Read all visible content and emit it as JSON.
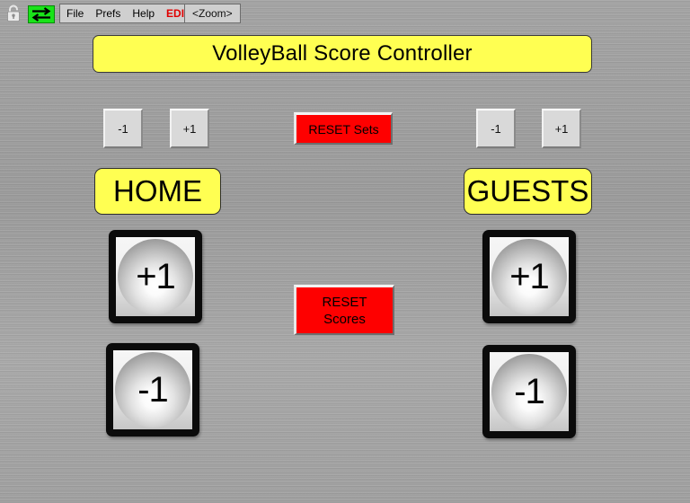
{
  "menubar": {
    "lock_icon": "padlock-unlocked-icon",
    "swap_icon": "swap-arrows-icon",
    "items": [
      {
        "label": "File",
        "style": "normal"
      },
      {
        "label": "Prefs",
        "style": "normal"
      },
      {
        "label": "Help",
        "style": "normal"
      },
      {
        "label": "EDIT",
        "style": "edit"
      }
    ],
    "zoom_button": "<Zoom>"
  },
  "title": {
    "text": "VolleyBall Score Controller",
    "background": "#ffff52",
    "text_color": "#000000"
  },
  "controls": {
    "sets": {
      "home": {
        "minus": "-1",
        "plus": "+1"
      },
      "guests": {
        "minus": "-1",
        "plus": "+1"
      },
      "reset_label": "RESET Sets"
    },
    "scores": {
      "reset_line1": "RESET",
      "reset_line2": "Scores",
      "home": {
        "plus": "+1",
        "minus": "-1"
      },
      "guests": {
        "plus": "+1",
        "minus": "-1"
      }
    }
  },
  "teams": {
    "home": {
      "name": "HOME"
    },
    "guests": {
      "name": "GUESTS"
    }
  },
  "colors": {
    "accent_yellow": "#ffff52",
    "reset_red": "#fe0000",
    "edit_red": "#e00000",
    "swap_green": "#19e319",
    "background_gray": "#9c9c9c"
  }
}
